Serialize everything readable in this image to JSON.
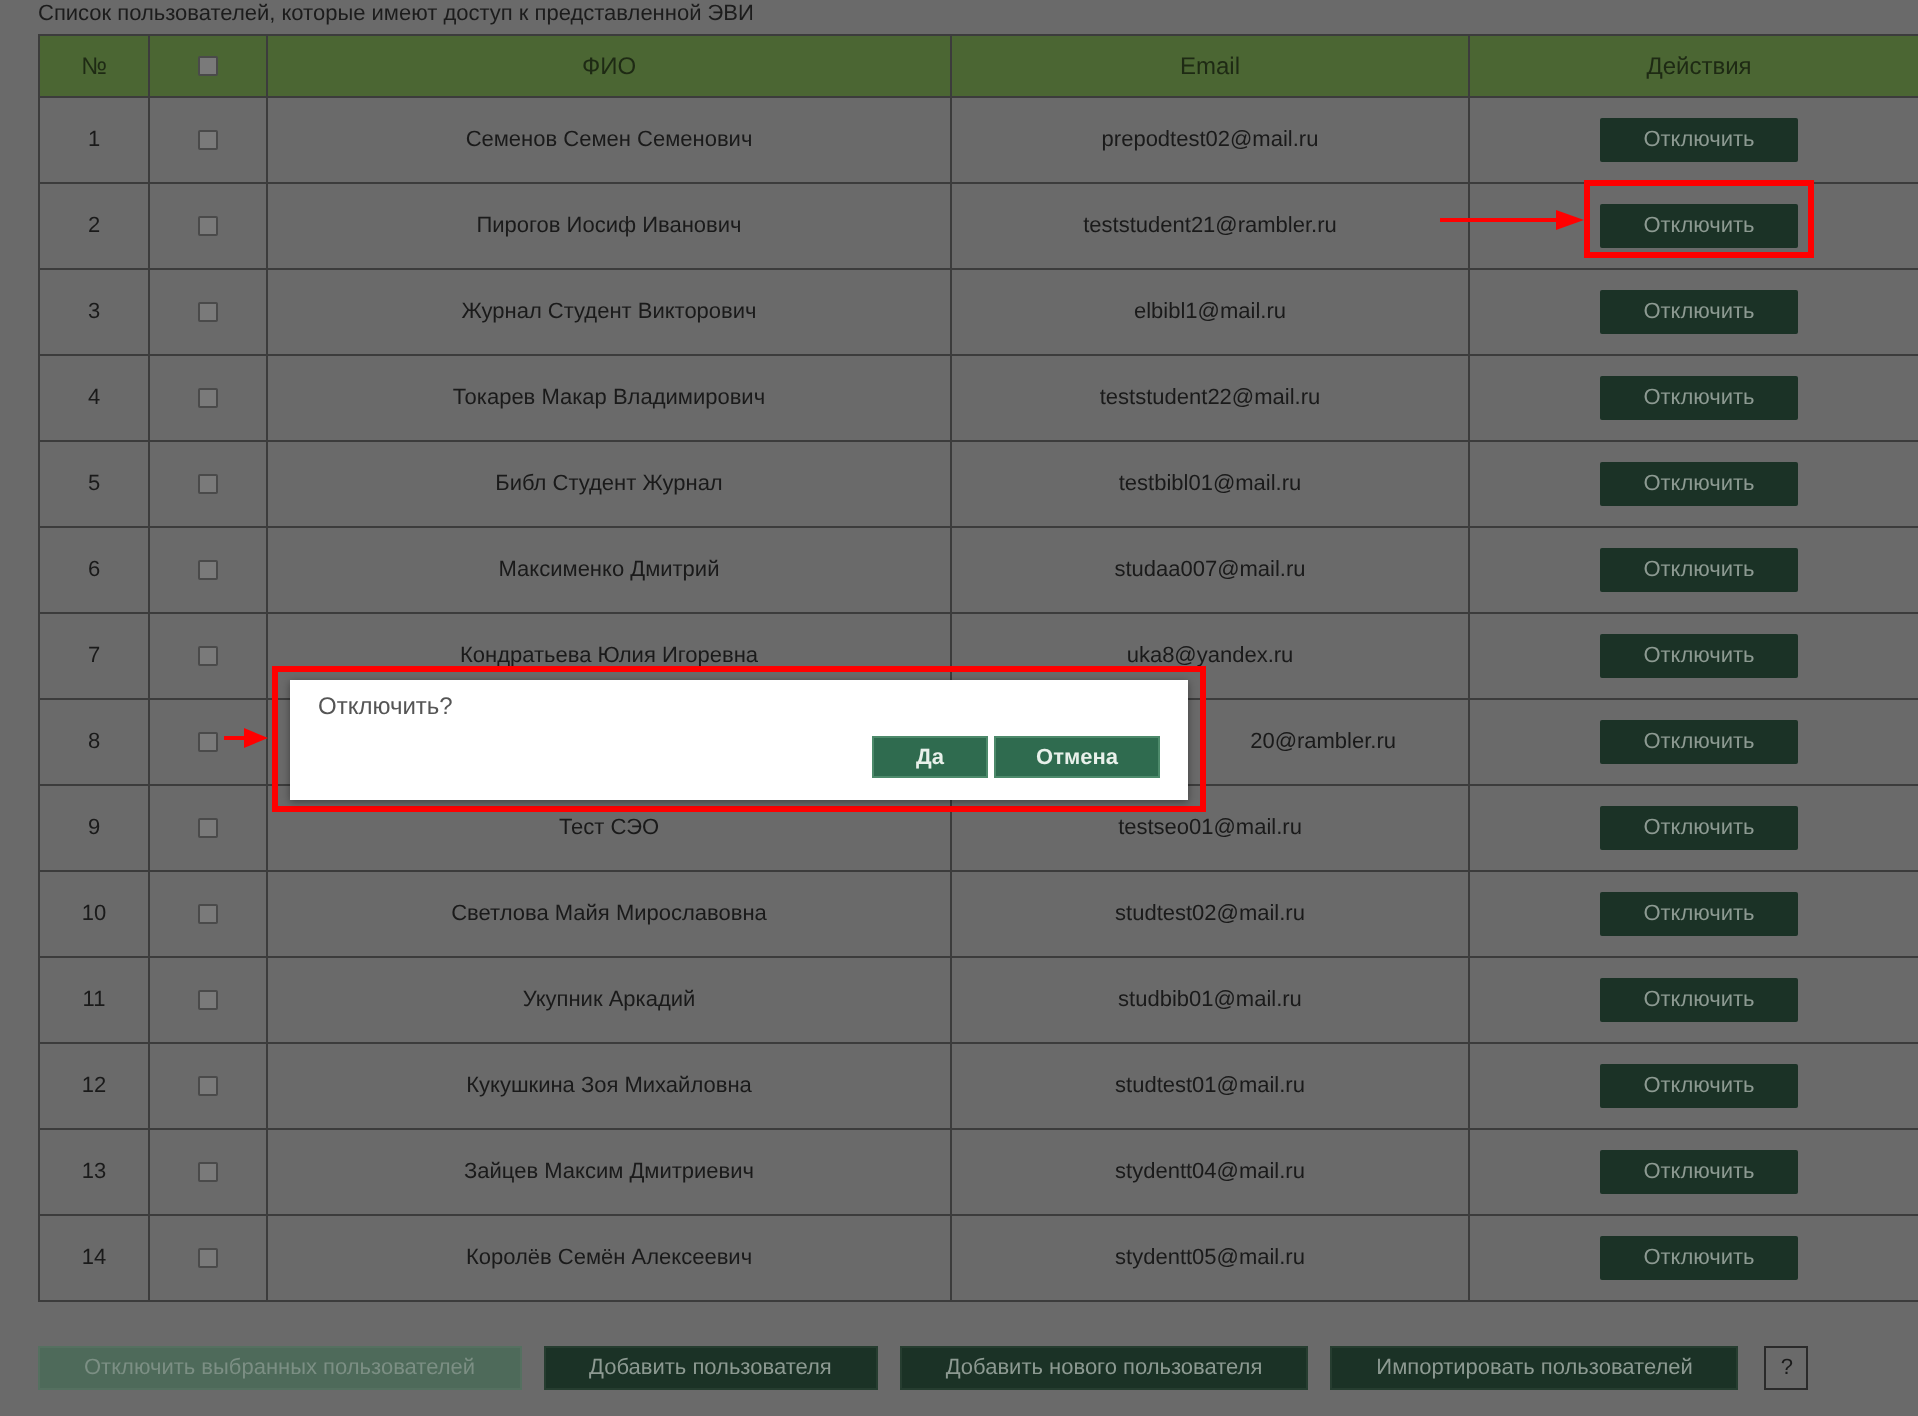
{
  "caption": "Список пользователей, которые имеют доступ к представленной ЭВИ",
  "table": {
    "columns": [
      {
        "kind": "text",
        "label": "№"
      },
      {
        "kind": "checkbox",
        "checked": false
      },
      {
        "kind": "text",
        "label": "ФИО"
      },
      {
        "kind": "text",
        "label": "Email"
      },
      {
        "kind": "text",
        "label": "Действия"
      }
    ],
    "rows": [
      {
        "number": "1",
        "checked": false,
        "name": "Семенов Семен Семенович",
        "email": "prepodtest02@mail.ru",
        "action": "Отключить"
      },
      {
        "number": "2",
        "checked": false,
        "name": "Пирогов Иосиф Иванович",
        "email": "teststudent21@rambler.ru",
        "action": "Отключить"
      },
      {
        "number": "3",
        "checked": false,
        "name": "Журнал Студент Викторович",
        "email": "elbibl1@mail.ru",
        "action": "Отключить"
      },
      {
        "number": "4",
        "checked": false,
        "name": "Токарев Макар Владимирович",
        "email": "teststudent22@mail.ru",
        "action": "Отключить"
      },
      {
        "number": "5",
        "checked": false,
        "name": "Библ Студент Журнал",
        "email": "testbibl01@mail.ru",
        "action": "Отключить"
      },
      {
        "number": "6",
        "checked": false,
        "name": "Максименко Дмитрий",
        "email": "studaa007@mail.ru",
        "action": "Отключить"
      },
      {
        "number": "7",
        "checked": false,
        "name": "Кондратьева Юлия Игоревна",
        "email": "uka8@yandex.ru",
        "action": "Отключить"
      },
      {
        "number": "8",
        "checked": false,
        "email": "20@rambler.ru",
        "action": "Отключить"
      },
      {
        "number": "9",
        "checked": false,
        "name": "Тест СЭО",
        "email": "testseo01@mail.ru",
        "action": "Отключить"
      },
      {
        "number": "10",
        "checked": false,
        "name": "Светлова Майя Мирославовна",
        "email": "studtest02@mail.ru",
        "action": "Отключить"
      },
      {
        "number": "11",
        "checked": false,
        "name": "Укупник Аркадий",
        "email": "studbib01@mail.ru",
        "action": "Отключить"
      },
      {
        "number": "12",
        "checked": false,
        "name": "Кукушкина Зоя Михайловна",
        "email": "studtest01@mail.ru",
        "action": "Отключить"
      },
      {
        "number": "13",
        "checked": false,
        "name": "Зайцев Максим Дмитриевич",
        "email": "stydentt04@mail.ru",
        "action": "Отключить"
      },
      {
        "number": "14",
        "checked": false,
        "name": "Королёв Семён Алексеевич",
        "email": "stydentt05@mail.ru",
        "action": "Отключить"
      }
    ]
  },
  "buttons": [
    {
      "label": "Отключить выбранных пользователей",
      "disabled": true
    },
    {
      "label": "Добавить пользователя",
      "disabled": false
    },
    {
      "label": "Добавить нового пользователя",
      "disabled": false
    },
    {
      "label": "Импортировать пользователей",
      "disabled": false
    }
  ],
  "help": "?",
  "dialog": {
    "message": "Отключить?",
    "buttons": [
      "Да",
      "Отмена"
    ]
  }
}
